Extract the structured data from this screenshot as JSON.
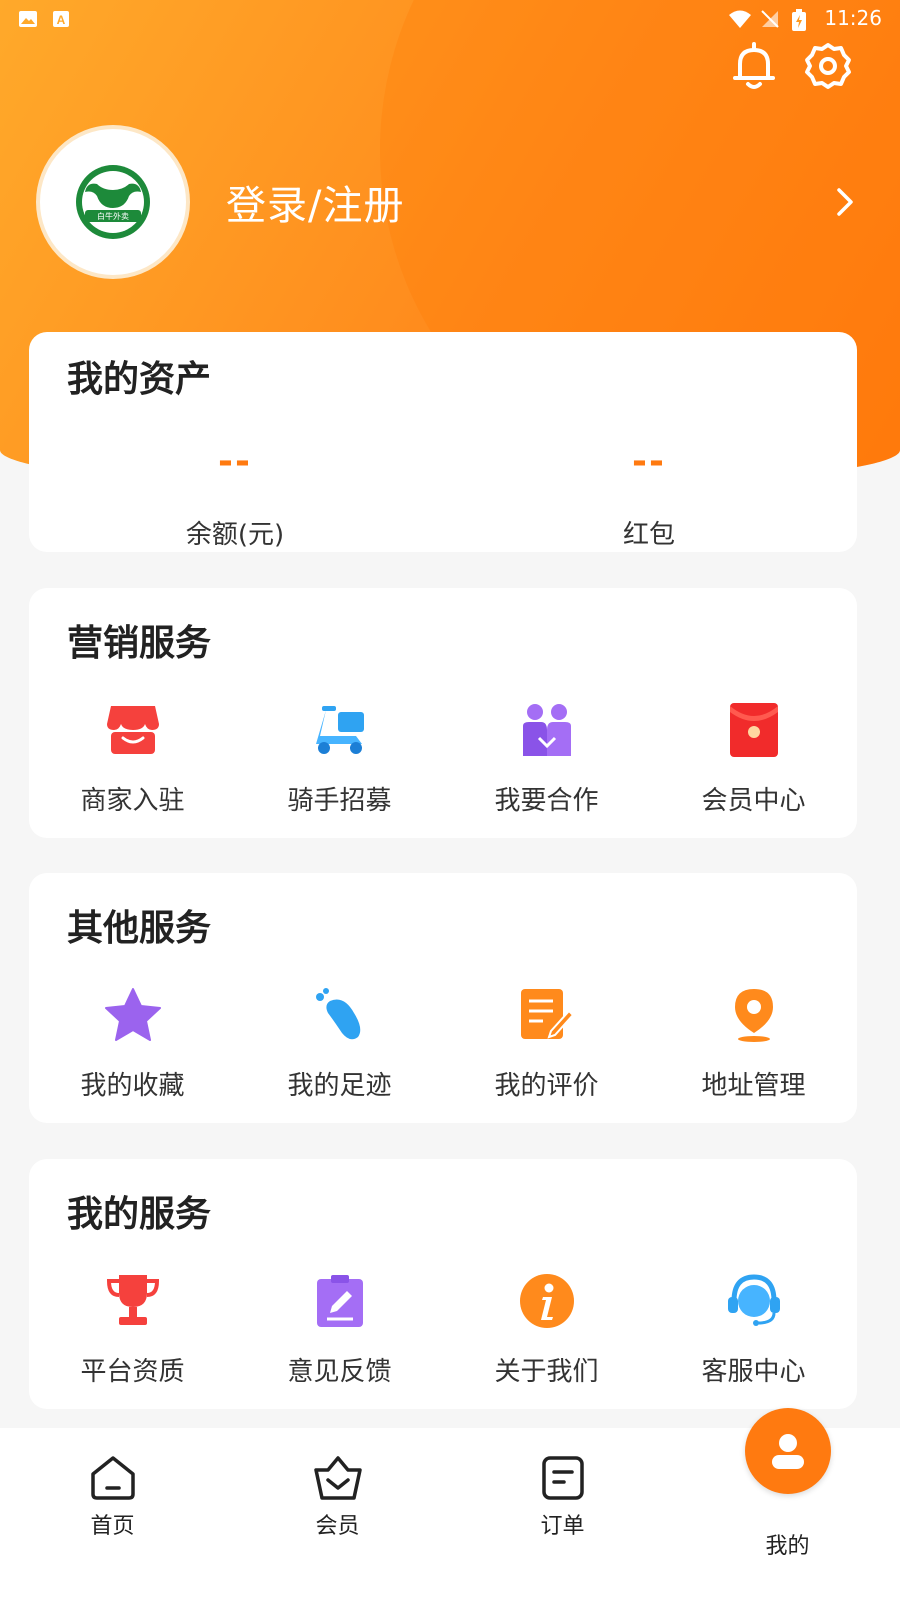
{
  "status_bar": {
    "time": "11:26"
  },
  "header": {
    "login_label": "登录/注册",
    "logo_text": "白牛外卖"
  },
  "assets": {
    "title": "我的资产",
    "items": [
      {
        "value": "--",
        "label": "余额(元)"
      },
      {
        "value": "--",
        "label": "红包"
      }
    ]
  },
  "marketing": {
    "title": "营销服务",
    "items": [
      {
        "label": "商家入驻",
        "icon": "store-icon"
      },
      {
        "label": "骑手招募",
        "icon": "scooter-icon"
      },
      {
        "label": "我要合作",
        "icon": "partners-icon"
      },
      {
        "label": "会员中心",
        "icon": "red-envelope-icon"
      }
    ]
  },
  "other": {
    "title": "其他服务",
    "items": [
      {
        "label": "我的收藏",
        "icon": "star-icon"
      },
      {
        "label": "我的足迹",
        "icon": "footprint-icon"
      },
      {
        "label": "我的评价",
        "icon": "review-icon"
      },
      {
        "label": "地址管理",
        "icon": "location-pin-icon"
      }
    ]
  },
  "mine": {
    "title": "我的服务",
    "items": [
      {
        "label": "平台资质",
        "icon": "trophy-icon"
      },
      {
        "label": "意见反馈",
        "icon": "feedback-icon"
      },
      {
        "label": "关于我们",
        "icon": "info-icon"
      },
      {
        "label": "客服中心",
        "icon": "headset-icon"
      }
    ]
  },
  "tabbar": {
    "items": [
      {
        "label": "首页",
        "icon": "home-icon"
      },
      {
        "label": "会员",
        "icon": "crown-basket-icon"
      },
      {
        "label": "订单",
        "icon": "order-icon"
      },
      {
        "label": "我的",
        "icon": "profile-icon",
        "active": true
      }
    ]
  },
  "colors": {
    "accent": "#ff7a10",
    "header_light": "#ffa92a"
  }
}
